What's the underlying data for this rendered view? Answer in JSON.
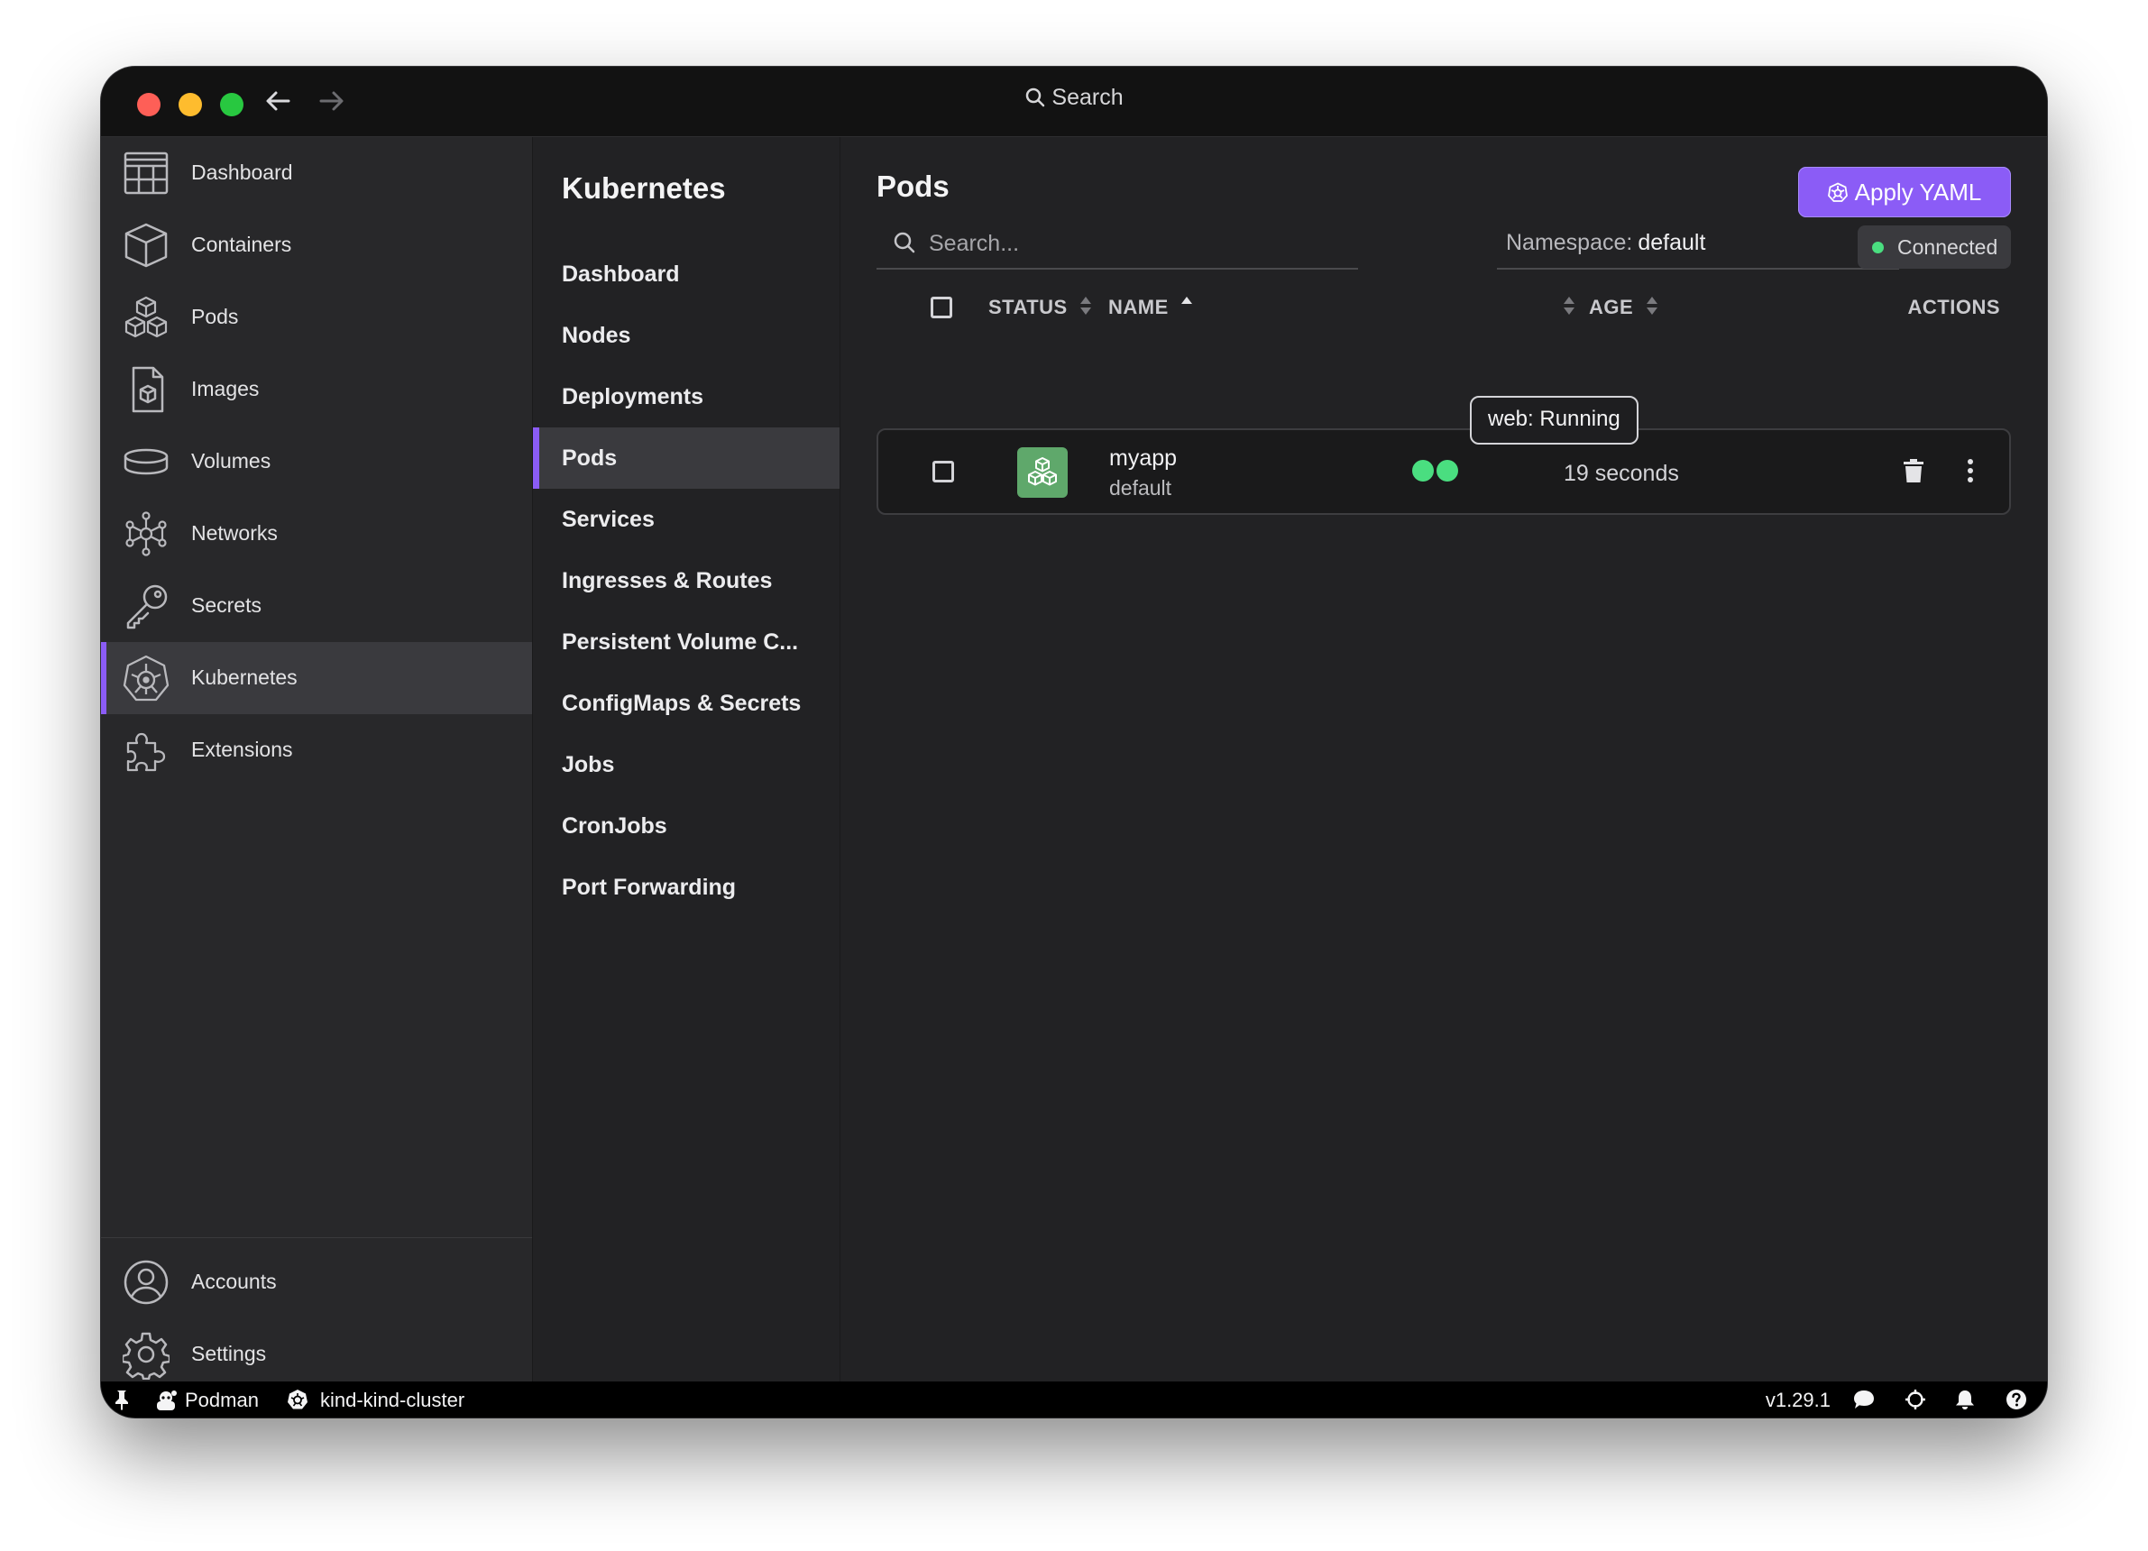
{
  "titlebar": {
    "search_label": "Search"
  },
  "leftnav": {
    "items": [
      {
        "label": "Dashboard",
        "icon": "dashboard-icon"
      },
      {
        "label": "Containers",
        "icon": "container-icon"
      },
      {
        "label": "Pods",
        "icon": "pods-icon"
      },
      {
        "label": "Images",
        "icon": "image-icon"
      },
      {
        "label": "Volumes",
        "icon": "volume-icon"
      },
      {
        "label": "Networks",
        "icon": "network-icon"
      },
      {
        "label": "Secrets",
        "icon": "key-icon"
      },
      {
        "label": "Kubernetes",
        "icon": "kubernetes-icon",
        "active": true
      },
      {
        "label": "Extensions",
        "icon": "puzzle-icon"
      }
    ],
    "bottom": [
      {
        "label": "Accounts",
        "icon": "account-icon"
      },
      {
        "label": "Settings",
        "icon": "gear-icon"
      }
    ]
  },
  "subnav": {
    "title": "Kubernetes",
    "items": [
      {
        "label": "Dashboard"
      },
      {
        "label": "Nodes"
      },
      {
        "label": "Deployments"
      },
      {
        "label": "Pods",
        "active": true
      },
      {
        "label": "Services"
      },
      {
        "label": "Ingresses & Routes"
      },
      {
        "label": "Persistent Volume C..."
      },
      {
        "label": "ConfigMaps & Secrets"
      },
      {
        "label": "Jobs"
      },
      {
        "label": "CronJobs"
      },
      {
        "label": "Port Forwarding"
      }
    ]
  },
  "main": {
    "title": "Pods",
    "apply_label": "Apply YAML",
    "search_placeholder": "Search...",
    "namespace_label": "Namespace:",
    "namespace_value": "default",
    "connection_status": "Connected",
    "columns": {
      "status": "STATUS",
      "name": "NAME",
      "age": "AGE",
      "actions": "ACTIONS"
    },
    "rows": [
      {
        "name": "myapp",
        "namespace": "default",
        "age": "19 seconds",
        "containers": 2,
        "status_color": "#4ade80"
      }
    ],
    "tooltip": "web: Running"
  },
  "statusbar": {
    "engine": "Podman",
    "context": "kind-kind-cluster",
    "version": "v1.29.1"
  },
  "colors": {
    "accent": "#8b5cf6",
    "pod_icon_bg": "#5fa86b",
    "running": "#4ade80"
  }
}
